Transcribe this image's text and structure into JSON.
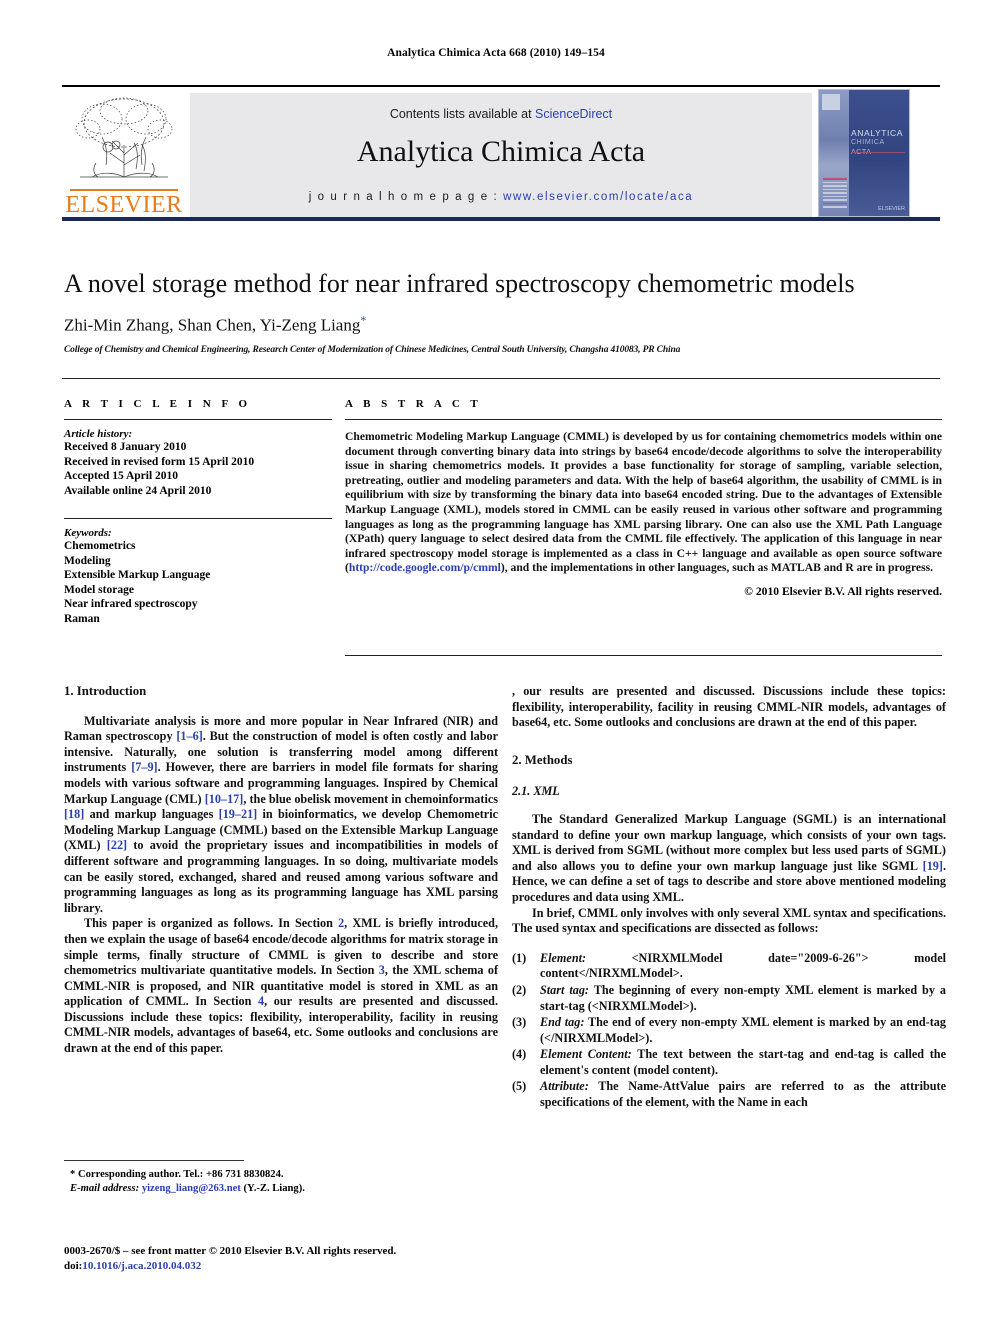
{
  "running_head": "Analytica Chimica Acta 668 (2010) 149–154",
  "masthead": {
    "publisher": "ELSEVIER",
    "contents_prefix": "Contents lists available at ",
    "contents_link": "ScienceDirect",
    "journal_title": "Analytica Chimica Acta",
    "homepage_label": "j o u r n a l   h o m e p a g e :   ",
    "homepage_url": "www.elsevier.com/locate/aca",
    "cover_title_line1": "ANALYTICA",
    "cover_title_line2": "CHIMICA ACTA",
    "cover_publisher": "ELSEVIER"
  },
  "paper": {
    "title": "A novel storage method for near infrared spectroscopy chemometric models",
    "authors": "Zhi-Min Zhang, Shan Chen, Yi-Zeng Liang",
    "corresponding_marker": "*",
    "affiliation": "College of Chemistry and Chemical Engineering, Research Center of Modernization of Chinese Medicines, Central South University, Changsha 410083, PR China"
  },
  "article_info": {
    "heading": "A R T I C L E    I N F O",
    "history_label": "Article history:",
    "history": [
      "Received 8 January 2010",
      "Received in revised form 15 April 2010",
      "Accepted 15 April 2010",
      "Available online 24 April 2010"
    ],
    "keywords_label": "Keywords:",
    "keywords": [
      "Chemometrics",
      "Modeling",
      "Extensible Markup Language",
      "Model storage",
      "Near infrared spectroscopy",
      "Raman"
    ]
  },
  "abstract": {
    "heading": "A B S T R A C T",
    "part1": "Chemometric Modeling Markup Language (CMML) is developed by us for containing chemometrics models within one document through converting binary data into strings by base64 encode/decode algorithms to solve the interoperability issue in sharing chemometrics models. It provides a base functionality for storage of sampling, variable selection, pretreating, outlier and modeling parameters and data. With the help of base64 algorithm, the usability of CMML is in equilibrium with size by transforming the binary data into base64 encoded string. Due to the advantages of Extensible Markup Language (XML), models stored in CMML can be easily reused in various other software and programming languages as long as the programming language has XML parsing library. One can also use the XML Path Language (XPath) query language to select desired data from the CMML file effectively. The application of this language in near infrared spectroscopy model storage is implemented as a class in C++ language and available as open source software (",
    "link": "http://code.google.com/p/cmml",
    "part2": "), and the implementations in other languages, such as MATLAB and R are in progress.",
    "copyright": "© 2010 Elsevier B.V. All rights reserved."
  },
  "sections": {
    "introduction_heading": "1.  Introduction",
    "intro_p1_a": "Multivariate analysis is more and more popular in Near Infrared (NIR) and Raman spectroscopy ",
    "intro_ref1": "[1–6]",
    "intro_p1_b": ". But the construction of model is often costly and labor intensive. Naturally, one solution is transferring model among different instruments ",
    "intro_ref2": "[7–9]",
    "intro_p1_c": ". However, there are barriers in model file formats for sharing models with various software and programming languages. Inspired by Chemical Markup Language (CML) ",
    "intro_ref3": "[10–17]",
    "intro_p1_d": ", the blue obelisk movement in chemoinformatics ",
    "intro_ref4": "[18]",
    "intro_p1_e": " and markup languages ",
    "intro_ref5": "[19–21]",
    "intro_p1_f": " in bioinformatics, we develop Chemometric Modeling Markup Language (CMML) based on the Extensible Markup Language (XML) ",
    "intro_ref6": "[22]",
    "intro_p1_g": " to avoid the proprietary issues and incompatibilities in models of different software and programming languages. In so doing, multivariate models can be easily stored, exchanged, shared and reused among various software and programming languages as long as its programming language has XML parsing library.",
    "intro_p2_a": "This paper is organized as follows. In Section ",
    "intro_sec2": "2",
    "intro_p2_b": ", XML is briefly introduced, then we explain the usage of base64 encode/decode algorithms for matrix storage in simple terms, finally structure of CMML is given to describe and store chemometrics multivariate quantitative models. In Section ",
    "intro_sec3": "3",
    "intro_p2_c": ", the XML schema of CMML-NIR is proposed, and NIR quantitative model is stored in XML as an application of CMML. In Section ",
    "intro_sec4": "4",
    "intro_p2_d": ", our results are presented and discussed. Discussions include these topics: flexibility, interoperability, facility in reusing CMML-NIR models, advantages of base64, etc. Some outlooks and conclusions are drawn at the end of this paper.",
    "methods_heading": "2.  Methods",
    "xml_heading": "2.1.  XML",
    "xml_p1_a": "The Standard Generalized Markup Language (SGML) is an international standard to define your own markup language, which consists of your own tags. XML is derived from SGML (without more complex but less used parts of SGML) and also allows you to define your own markup language just like SGML ",
    "xml_ref19": "[19]",
    "xml_p1_b": ". Hence, we can define a set of tags to describe and store above mentioned modeling procedures and data using XML.",
    "xml_p2": "In brief, CMML only involves with only several XML syntax and specifications. The used syntax and specifications are dissected as follows:"
  },
  "syntax_list": [
    {
      "marker": "(1)",
      "term": "Element:",
      "text": " <NIRXMLModel date=\"2009-6-26\"> model content</NIRXMLModel>."
    },
    {
      "marker": "(2)",
      "term": "Start tag:",
      "text": " The beginning of every non-empty XML element is marked by a start-tag (<NIRXMLModel>)."
    },
    {
      "marker": "(3)",
      "term": "End tag:",
      "text": " The end of every non-empty XML element is marked by an end-tag (</NIRXMLModel>)."
    },
    {
      "marker": "(4)",
      "term": "Element Content:",
      "text": " The text between the start-tag and end-tag is called the element's content (model content)."
    },
    {
      "marker": "(5)",
      "term": "Attribute:",
      "text": " The Name-AttValue pairs are referred to as the attribute specifications of the element, with the Name in each"
    }
  ],
  "footnote": {
    "corresponding": "* Corresponding author. Tel.: +86 731 8830824.",
    "email_label": "E-mail address:",
    "email": "yizeng_liang@263.net",
    "email_suffix": " (Y.-Z. Liang).",
    "imprint": "0003-2670/$ – see front matter © 2010 Elsevier B.V. All rights reserved.",
    "doi_label": "doi:",
    "doi": "10.1016/j.aca.2010.04.032"
  },
  "colors": {
    "link": "#2A3FAF",
    "elsevier_orange": "#E87C18",
    "banner_gray": "#e8e8ea",
    "rule_navy": "#1b2a5e"
  }
}
